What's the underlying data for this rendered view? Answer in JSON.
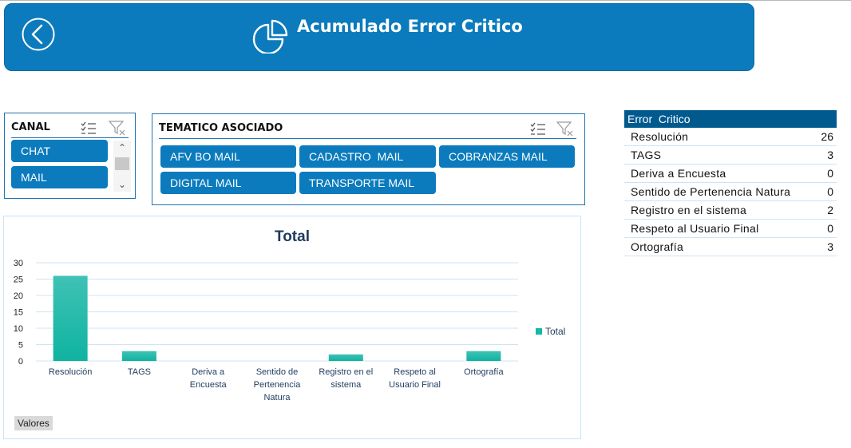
{
  "header": {
    "title": "Acumulado Error Critico",
    "color": "#0b7bbd"
  },
  "canal_slicer": {
    "title": "CANAL",
    "items": [
      "CHAT",
      "MAIL"
    ]
  },
  "tematico_slicer": {
    "title": "TEMATICO ASOCIADO",
    "items": [
      "AFV BO MAIL",
      "CADASTRO  MAIL",
      "COBRANZAS MAIL",
      "DIGITAL MAIL",
      "TRANSPORTE MAIL"
    ]
  },
  "chart": {
    "valores_label": "Valores"
  },
  "chart_data": {
    "type": "bar",
    "title": "Total",
    "categories": [
      [
        "Resolución"
      ],
      [
        "TAGS"
      ],
      [
        "Deriva a",
        "Encuesta"
      ],
      [
        "Sentido de",
        "Pertenencia",
        "Natura"
      ],
      [
        "Registro en el",
        "sistema"
      ],
      [
        "Respeto al",
        "Usuario Final"
      ],
      [
        "Ortografía"
      ]
    ],
    "series": [
      {
        "name": "Total",
        "values": [
          26,
          3,
          0,
          0,
          2,
          0,
          3
        ],
        "color": "#14b8a6"
      }
    ],
    "yticks": [
      "0",
      "5",
      "10",
      "15",
      "20",
      "25",
      "30"
    ],
    "ylim": [
      0,
      30
    ],
    "grid": true,
    "legend": "right"
  },
  "table": {
    "header": "Error  Critico",
    "rows": [
      {
        "label": "Resolución",
        "value": "26"
      },
      {
        "label": "TAGS",
        "value": "3"
      },
      {
        "label": "Deriva a Encuesta",
        "value": "0"
      },
      {
        "label": "Sentido de Pertenencia Natura",
        "value": "0"
      },
      {
        "label": "Registro en el sistema",
        "value": "2"
      },
      {
        "label": "Respeto al Usuario Final",
        "value": "0"
      },
      {
        "label": "Ortografía",
        "value": "3"
      }
    ]
  }
}
